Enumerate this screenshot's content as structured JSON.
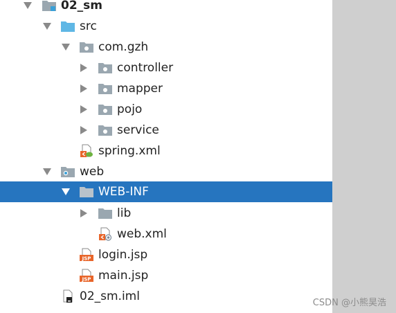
{
  "tree": {
    "items": [
      {
        "label": "02_sm",
        "icon": "module-folder-icon",
        "expanded": true
      },
      {
        "label": "src",
        "icon": "source-folder-icon",
        "expanded": true
      },
      {
        "label": "com.gzh",
        "icon": "package-icon",
        "expanded": true
      },
      {
        "label": "controller",
        "icon": "package-icon",
        "expanded": false
      },
      {
        "label": "mapper",
        "icon": "package-icon",
        "expanded": false
      },
      {
        "label": "pojo",
        "icon": "package-icon",
        "expanded": false
      },
      {
        "label": "service",
        "icon": "package-icon",
        "expanded": false
      },
      {
        "label": "spring.xml",
        "icon": "spring-xml-file-icon"
      },
      {
        "label": "web",
        "icon": "web-folder-icon",
        "expanded": true
      },
      {
        "label": "WEB-INF",
        "icon": "folder-icon",
        "expanded": true,
        "selected": true
      },
      {
        "label": "lib",
        "icon": "folder-icon",
        "expanded": false
      },
      {
        "label": "web.xml",
        "icon": "web-xml-file-icon"
      },
      {
        "label": "login.jsp",
        "icon": "jsp-file-icon"
      },
      {
        "label": "main.jsp",
        "icon": "jsp-file-icon"
      },
      {
        "label": "02_sm.iml",
        "icon": "iml-file-icon"
      }
    ]
  },
  "colors": {
    "selection": "#2675bf",
    "folder": "#9aa7b0",
    "source_folder": "#5fb7e5",
    "jsp_badge": "#e8652a",
    "scrollbar_gutter": "#cfcfcf"
  },
  "watermark": "CSDN @小熊昊浩"
}
